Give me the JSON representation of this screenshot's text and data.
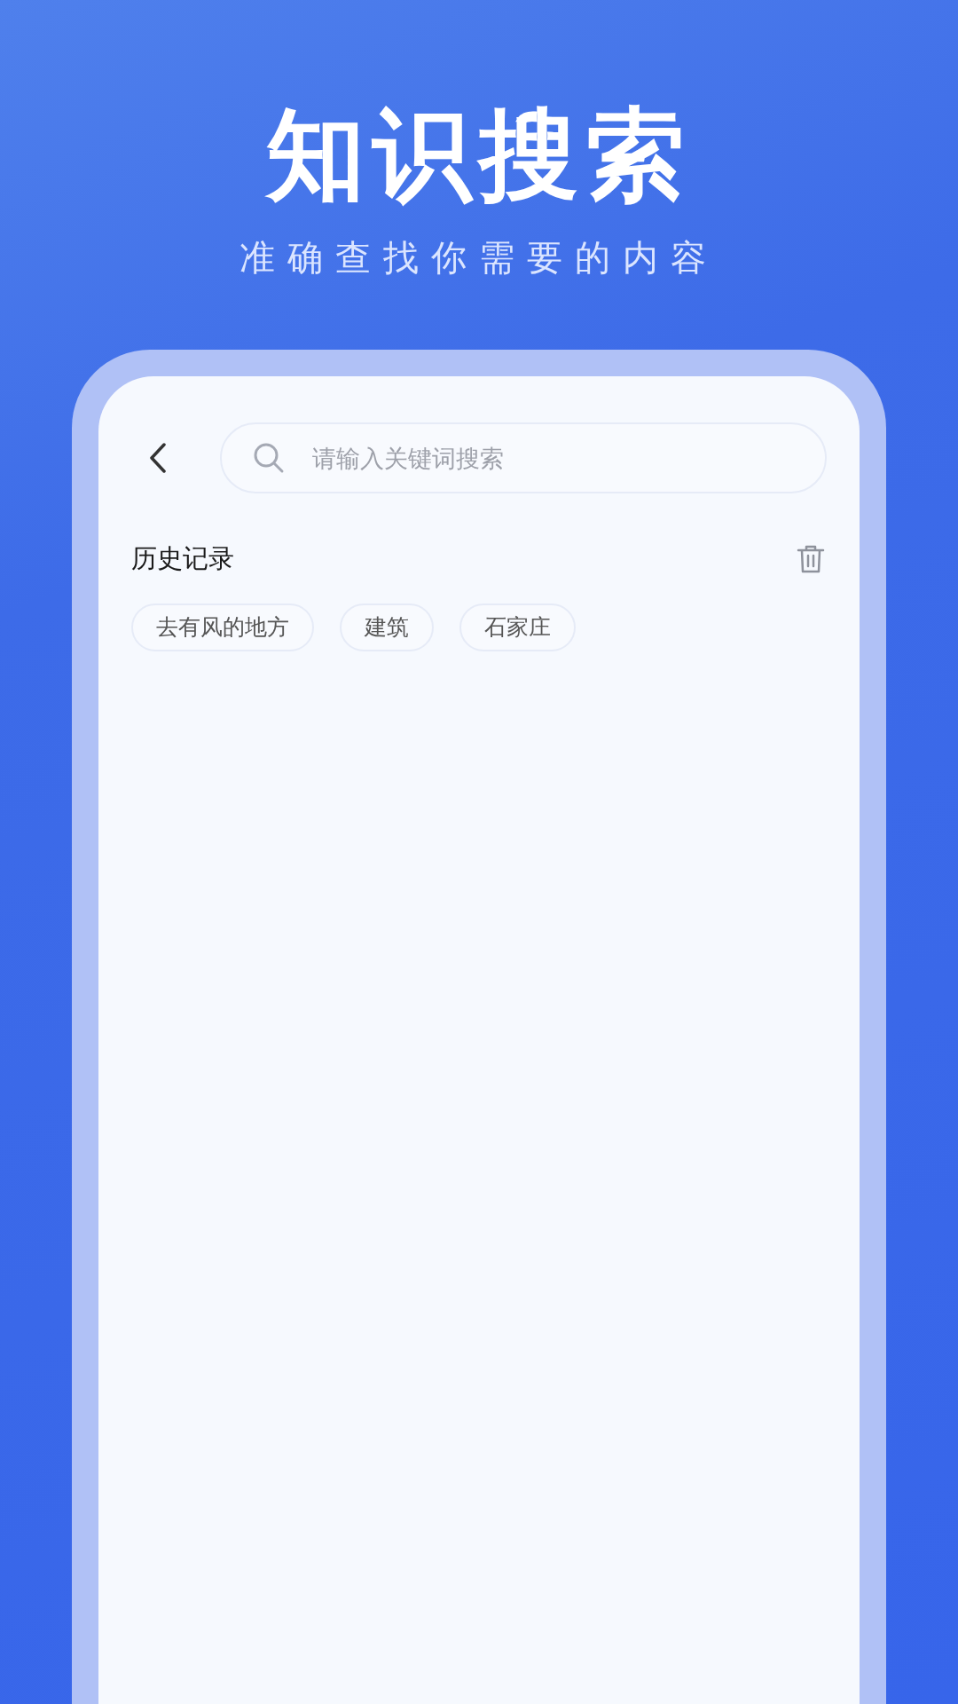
{
  "headline": "知识搜索",
  "subtitle": "准确查找你需要的内容",
  "search": {
    "placeholder": "请输入关键词搜索"
  },
  "history": {
    "title": "历史记录",
    "items": [
      "去有风的地方",
      "建筑",
      "石家庄"
    ]
  }
}
